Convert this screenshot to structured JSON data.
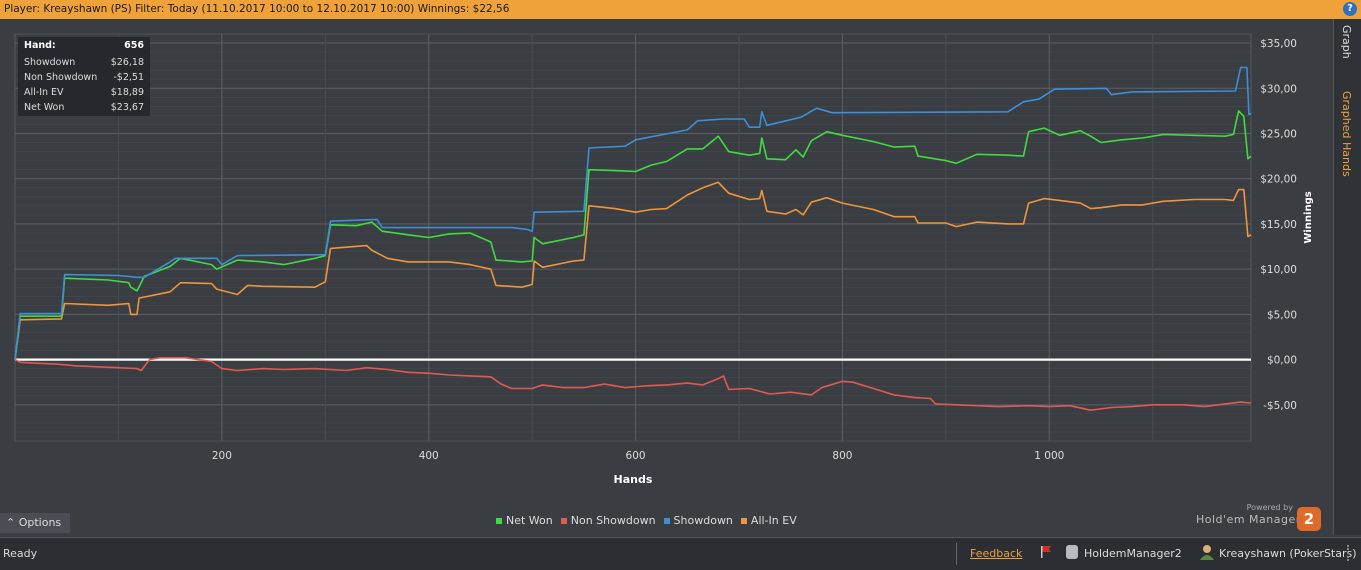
{
  "header": {
    "title": "Player: Kreayshawn (PS) Filter: Today (11.10.2017 10:00 to 12.10.2017 10:00) Winnings: $22,56",
    "help_label": "?"
  },
  "side_tabs": {
    "graph": "Graph",
    "graphed_hands": "Graphed Hands"
  },
  "stats": {
    "hand_label": "Hand:",
    "hand_value": "656",
    "rows": [
      {
        "label": "Showdown",
        "value": "$26,18"
      },
      {
        "label": "Non Showdown",
        "value": "-$2,51"
      },
      {
        "label": "All-In EV",
        "value": "$18,89"
      },
      {
        "label": "Net Won",
        "value": "$23,67"
      }
    ]
  },
  "options_label": "Options",
  "powered_label": "Powered by",
  "brand_label": "Hold'em Manager",
  "logo_label": "2",
  "status": {
    "text": "Ready",
    "feedback": "Feedback",
    "app": "HoldemManager2",
    "user": "Kreayshawn (PokerStars)"
  },
  "colors": {
    "net_won": "#3fdc3f",
    "non_showdown": "#e05a55",
    "showdown": "#3d8fd8",
    "all_in_ev": "#f0953a",
    "accent": "#f0a23a"
  },
  "chart_data": {
    "type": "line",
    "xlabel": "Hands",
    "ylabel": "Winnings",
    "xlim": [
      0,
      1195
    ],
    "ylim": [
      -9,
      36
    ],
    "x_ticks": [
      200,
      400,
      600,
      800,
      1000
    ],
    "x_tick_labels": [
      "200",
      "400",
      "600",
      "800",
      "1 000"
    ],
    "y_ticks": [
      -5,
      0,
      5,
      10,
      15,
      20,
      25,
      30,
      35
    ],
    "y_tick_labels": [
      "-$5,00",
      "$0,00",
      "$5,00",
      "$10,00",
      "$15,00",
      "$20,00",
      "$25,00",
      "$30,00",
      "$35,00"
    ],
    "legend_position": "bottom",
    "grid": true,
    "series": [
      {
        "name": "Net Won",
        "color": "#3fdc3f",
        "points": [
          [
            0,
            0
          ],
          [
            5,
            4.8
          ],
          [
            45,
            4.8
          ],
          [
            48,
            9
          ],
          [
            90,
            8.8
          ],
          [
            110,
            8.5
          ],
          [
            112,
            8
          ],
          [
            118,
            7.6
          ],
          [
            125,
            9.2
          ],
          [
            150,
            10.3
          ],
          [
            160,
            11.2
          ],
          [
            190,
            10.5
          ],
          [
            195,
            10
          ],
          [
            215,
            11
          ],
          [
            240,
            10.8
          ],
          [
            260,
            10.5
          ],
          [
            290,
            11.2
          ],
          [
            300,
            11.5
          ],
          [
            305,
            14.9
          ],
          [
            330,
            14.8
          ],
          [
            345,
            15.2
          ],
          [
            355,
            14.2
          ],
          [
            380,
            13.8
          ],
          [
            400,
            13.5
          ],
          [
            420,
            13.9
          ],
          [
            440,
            14
          ],
          [
            460,
            13
          ],
          [
            465,
            11
          ],
          [
            490,
            10.8
          ],
          [
            500,
            10.9
          ],
          [
            502,
            13.5
          ],
          [
            510,
            12.8
          ],
          [
            540,
            13.5
          ],
          [
            550,
            13.8
          ],
          [
            555,
            21
          ],
          [
            580,
            20.9
          ],
          [
            600,
            20.8
          ],
          [
            615,
            21.5
          ],
          [
            630,
            21.9
          ],
          [
            650,
            23.3
          ],
          [
            665,
            23.3
          ],
          [
            680,
            24.7
          ],
          [
            690,
            23
          ],
          [
            710,
            22.6
          ],
          [
            720,
            22.8
          ],
          [
            722,
            24.5
          ],
          [
            727,
            22.2
          ],
          [
            745,
            22.1
          ],
          [
            755,
            23.2
          ],
          [
            762,
            22.4
          ],
          [
            770,
            24.2
          ],
          [
            785,
            25.2
          ],
          [
            800,
            24.8
          ],
          [
            830,
            24.1
          ],
          [
            850,
            23.5
          ],
          [
            870,
            23.6
          ],
          [
            873,
            22.5
          ],
          [
            900,
            22
          ],
          [
            910,
            21.7
          ],
          [
            930,
            22.7
          ],
          [
            960,
            22.6
          ],
          [
            975,
            22.5
          ],
          [
            980,
            25.2
          ],
          [
            995,
            25.6
          ],
          [
            1010,
            24.8
          ],
          [
            1030,
            25.3
          ],
          [
            1040,
            24.7
          ],
          [
            1050,
            24
          ],
          [
            1070,
            24.3
          ],
          [
            1090,
            24.5
          ],
          [
            1110,
            24.9
          ],
          [
            1140,
            24.8
          ],
          [
            1170,
            24.7
          ],
          [
            1178,
            24.9
          ],
          [
            1183,
            27.5
          ],
          [
            1188,
            26.9
          ],
          [
            1192,
            22.2
          ],
          [
            1195,
            22.5
          ]
        ]
      },
      {
        "name": "Non Showdown",
        "color": "#e05a55",
        "points": [
          [
            0,
            0
          ],
          [
            5,
            -0.3
          ],
          [
            20,
            -0.4
          ],
          [
            40,
            -0.5
          ],
          [
            60,
            -0.7
          ],
          [
            80,
            -0.8
          ],
          [
            100,
            -0.9
          ],
          [
            118,
            -1
          ],
          [
            122,
            -1.2
          ],
          [
            130,
            0
          ],
          [
            140,
            0.2
          ],
          [
            165,
            0.2
          ],
          [
            190,
            -0.2
          ],
          [
            200,
            -1
          ],
          [
            215,
            -1.2
          ],
          [
            240,
            -1
          ],
          [
            260,
            -1.1
          ],
          [
            290,
            -1
          ],
          [
            320,
            -1.2
          ],
          [
            340,
            -0.9
          ],
          [
            360,
            -1.1
          ],
          [
            380,
            -1.4
          ],
          [
            400,
            -1.5
          ],
          [
            420,
            -1.7
          ],
          [
            440,
            -1.8
          ],
          [
            460,
            -1.9
          ],
          [
            470,
            -2.7
          ],
          [
            480,
            -3.2
          ],
          [
            500,
            -3.2
          ],
          [
            510,
            -2.8
          ],
          [
            530,
            -3.1
          ],
          [
            550,
            -3.1
          ],
          [
            570,
            -2.7
          ],
          [
            590,
            -3.1
          ],
          [
            610,
            -2.9
          ],
          [
            630,
            -2.8
          ],
          [
            650,
            -2.6
          ],
          [
            665,
            -2.8
          ],
          [
            680,
            -2.1
          ],
          [
            685,
            -1.8
          ],
          [
            690,
            -3.3
          ],
          [
            710,
            -3.2
          ],
          [
            730,
            -3.8
          ],
          [
            750,
            -3.6
          ],
          [
            770,
            -3.9
          ],
          [
            780,
            -3.1
          ],
          [
            800,
            -2.4
          ],
          [
            810,
            -2.5
          ],
          [
            830,
            -3.2
          ],
          [
            850,
            -3.9
          ],
          [
            870,
            -4.2
          ],
          [
            885,
            -4.3
          ],
          [
            890,
            -4.9
          ],
          [
            910,
            -5
          ],
          [
            950,
            -5.2
          ],
          [
            980,
            -5.1
          ],
          [
            1000,
            -5.2
          ],
          [
            1020,
            -5.1
          ],
          [
            1040,
            -5.6
          ],
          [
            1060,
            -5.3
          ],
          [
            1080,
            -5.2
          ],
          [
            1100,
            -5
          ],
          [
            1130,
            -5
          ],
          [
            1150,
            -5.2
          ],
          [
            1170,
            -4.9
          ],
          [
            1185,
            -4.7
          ],
          [
            1195,
            -4.8
          ]
        ]
      },
      {
        "name": "Showdown",
        "color": "#3d8fd8",
        "points": [
          [
            0,
            0
          ],
          [
            5,
            5.1
          ],
          [
            45,
            5.1
          ],
          [
            48,
            9.4
          ],
          [
            100,
            9.3
          ],
          [
            118,
            9.1
          ],
          [
            125,
            9.1
          ],
          [
            150,
            10.8
          ],
          [
            155,
            11.2
          ],
          [
            195,
            11.2
          ],
          [
            200,
            10.5
          ],
          [
            215,
            11.5
          ],
          [
            300,
            11.6
          ],
          [
            305,
            15.3
          ],
          [
            350,
            15.5
          ],
          [
            355,
            14.6
          ],
          [
            480,
            14.6
          ],
          [
            495,
            14.4
          ],
          [
            500,
            14.2
          ],
          [
            502,
            16.3
          ],
          [
            550,
            16.4
          ],
          [
            555,
            23.4
          ],
          [
            590,
            23.6
          ],
          [
            600,
            24.3
          ],
          [
            650,
            25.4
          ],
          [
            660,
            26.4
          ],
          [
            685,
            26.6
          ],
          [
            705,
            26.6
          ],
          [
            710,
            25.7
          ],
          [
            720,
            25.7
          ],
          [
            722,
            27.4
          ],
          [
            727,
            25.9
          ],
          [
            760,
            26.8
          ],
          [
            775,
            27.8
          ],
          [
            790,
            27.3
          ],
          [
            960,
            27.4
          ],
          [
            975,
            28.5
          ],
          [
            990,
            28.8
          ],
          [
            1005,
            29.9
          ],
          [
            1055,
            30
          ],
          [
            1060,
            29.3
          ],
          [
            1080,
            29.6
          ],
          [
            1180,
            29.7
          ],
          [
            1185,
            32.3
          ],
          [
            1191,
            32.3
          ],
          [
            1193,
            27.1
          ],
          [
            1195,
            27.2
          ]
        ]
      },
      {
        "name": "All-In EV",
        "color": "#f0953a",
        "points": [
          [
            0,
            0
          ],
          [
            5,
            4.4
          ],
          [
            45,
            4.5
          ],
          [
            48,
            6.2
          ],
          [
            90,
            6
          ],
          [
            110,
            6.2
          ],
          [
            112,
            5
          ],
          [
            118,
            5
          ],
          [
            120,
            6.8
          ],
          [
            150,
            7.5
          ],
          [
            160,
            8.5
          ],
          [
            190,
            8.4
          ],
          [
            195,
            7.8
          ],
          [
            215,
            7.2
          ],
          [
            225,
            8.2
          ],
          [
            240,
            8.1
          ],
          [
            290,
            8
          ],
          [
            300,
            8.6
          ],
          [
            305,
            12.3
          ],
          [
            340,
            12.6
          ],
          [
            345,
            12.1
          ],
          [
            360,
            11.2
          ],
          [
            380,
            10.8
          ],
          [
            420,
            10.8
          ],
          [
            440,
            10.5
          ],
          [
            460,
            10
          ],
          [
            465,
            8.2
          ],
          [
            490,
            8
          ],
          [
            500,
            8.3
          ],
          [
            502,
            10.9
          ],
          [
            510,
            10.2
          ],
          [
            540,
            10.9
          ],
          [
            550,
            11
          ],
          [
            555,
            17
          ],
          [
            580,
            16.7
          ],
          [
            600,
            16.3
          ],
          [
            615,
            16.6
          ],
          [
            630,
            16.7
          ],
          [
            650,
            18.2
          ],
          [
            665,
            19
          ],
          [
            680,
            19.6
          ],
          [
            690,
            18.4
          ],
          [
            710,
            17.7
          ],
          [
            720,
            17.8
          ],
          [
            722,
            18.7
          ],
          [
            727,
            16.4
          ],
          [
            745,
            16.1
          ],
          [
            755,
            16.6
          ],
          [
            762,
            16
          ],
          [
            770,
            17.4
          ],
          [
            785,
            17.9
          ],
          [
            800,
            17.3
          ],
          [
            830,
            16.6
          ],
          [
            850,
            15.8
          ],
          [
            870,
            15.8
          ],
          [
            873,
            15.1
          ],
          [
            900,
            15.1
          ],
          [
            910,
            14.7
          ],
          [
            930,
            15.2
          ],
          [
            960,
            15
          ],
          [
            975,
            15
          ],
          [
            980,
            17.3
          ],
          [
            995,
            17.8
          ],
          [
            1010,
            17.6
          ],
          [
            1030,
            17.3
          ],
          [
            1040,
            16.7
          ],
          [
            1050,
            16.8
          ],
          [
            1070,
            17.1
          ],
          [
            1090,
            17.1
          ],
          [
            1110,
            17.5
          ],
          [
            1140,
            17.7
          ],
          [
            1170,
            17.7
          ],
          [
            1178,
            17.6
          ],
          [
            1183,
            18.8
          ],
          [
            1188,
            18.8
          ],
          [
            1192,
            13.6
          ],
          [
            1195,
            13.8
          ]
        ]
      }
    ]
  }
}
